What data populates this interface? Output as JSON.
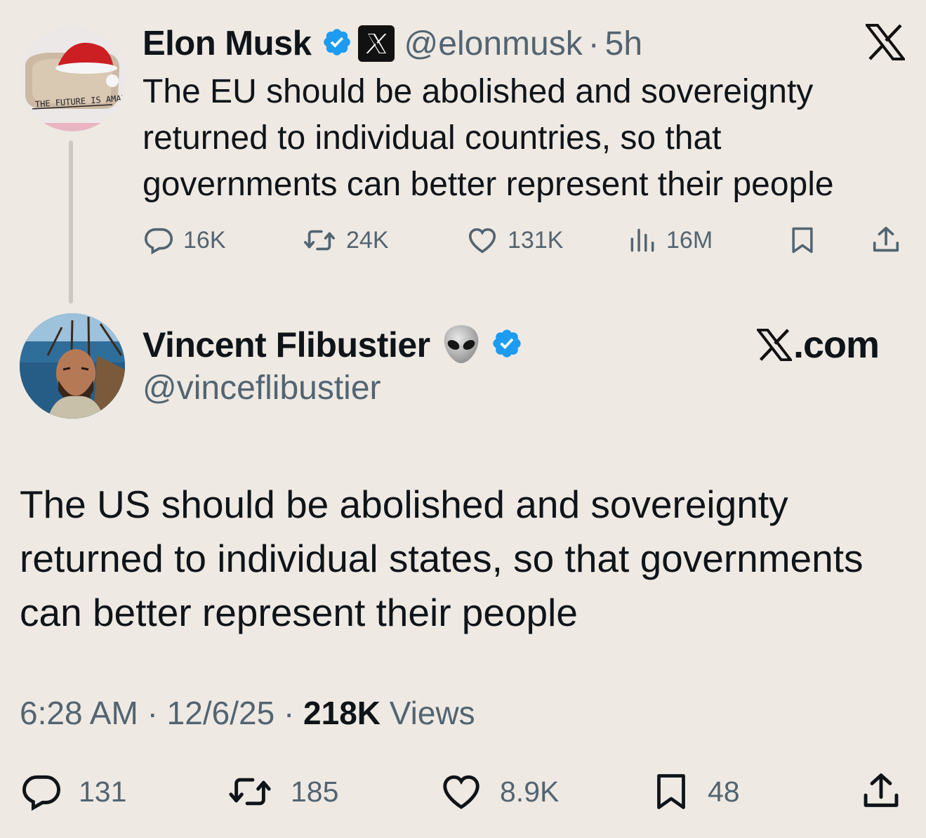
{
  "quoted_tweet": {
    "author_name": "Elon Musk",
    "handle": "@elonmusk",
    "separator": "·",
    "time_ago": "5h",
    "text": "The EU should be abolished and sovereignty returned to individual countries, so that governments can better represent their people",
    "replies": "16K",
    "reposts": "24K",
    "likes": "131K",
    "views": "16M",
    "avatar_caption": "THE FUTURE IS AMAZING"
  },
  "main_tweet": {
    "author_name": "Vincent Flibustier",
    "handle": "@vinceflibustier",
    "brand_text": ".com",
    "text": "The US should be abolished and sovereignty returned to individual states, so that governments can better represent their people",
    "time": "6:28 AM",
    "date": "12/6/25",
    "views_count": "218K",
    "views_label": "Views",
    "separator": "·",
    "replies": "131",
    "reposts": "185",
    "likes": "8.9K",
    "bookmarks": "48"
  },
  "icons": {
    "verified": "verified-badge-icon",
    "x_affiliate": "x-affiliate-badge-icon",
    "alien": "alien-emoji-icon",
    "reply": "reply-icon",
    "repost": "repost-icon",
    "like": "heart-icon",
    "views": "views-chart-icon",
    "bookmark": "bookmark-icon",
    "share": "share-icon",
    "x_logo": "x-logo-icon"
  },
  "colors": {
    "background": "#EEE9E3",
    "verified_blue": "#1D9BF0",
    "secondary_text": "#536471",
    "primary_text": "#0F1419"
  }
}
